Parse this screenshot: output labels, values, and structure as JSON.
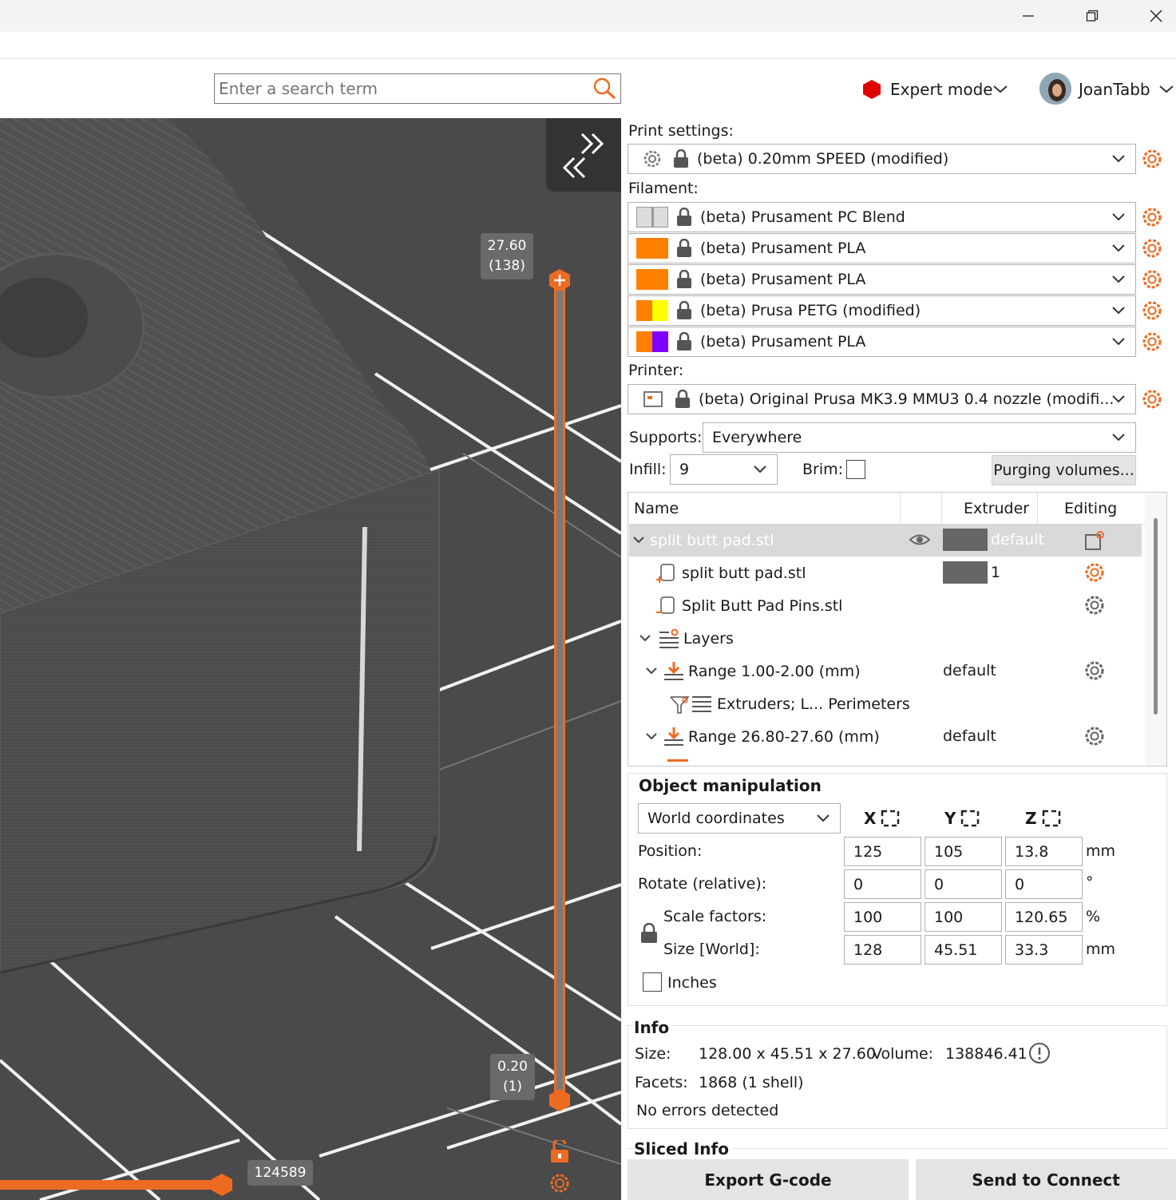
{
  "search": {
    "placeholder": "Enter a search term"
  },
  "mode": {
    "label": "Expert mode"
  },
  "user": {
    "name": "JoanTabb"
  },
  "viewport": {
    "top_slider": {
      "height": "27.60",
      "layer": "(138)"
    },
    "bottom_slider": {
      "height": "0.20",
      "layer": "(1)"
    },
    "h_slider": {
      "value": "124589"
    }
  },
  "print_settings": {
    "label": "Print settings:",
    "value": "(beta) 0.20mm SPEED (modified)"
  },
  "filament": {
    "label": "Filament:",
    "items": [
      {
        "name": "(beta) Prusament PC Blend",
        "colors": [
          "#dcdcdc",
          "#dcdcdc"
        ]
      },
      {
        "name": "(beta) Prusament PLA",
        "colors": [
          "#ff7f00",
          "#ff7f00"
        ]
      },
      {
        "name": "(beta) Prusament PLA",
        "colors": [
          "#ff7f00",
          "#ff7f00"
        ]
      },
      {
        "name": "(beta) Prusa PETG (modified)",
        "colors": [
          "#ff7f00",
          "#ffff00"
        ]
      },
      {
        "name": "(beta) Prusament PLA",
        "colors": [
          "#ff7f00",
          "#8000ff"
        ]
      }
    ]
  },
  "printer": {
    "label": "Printer:",
    "value": "(beta) Original Prusa MK3.9 MMU3 0.4 nozzle (modifi..."
  },
  "supports": {
    "label": "Supports:",
    "value": "Everywhere"
  },
  "infill": {
    "label": "Infill:",
    "value": "9"
  },
  "brim": {
    "label": "Brim:"
  },
  "purging_button": "Purging volumes...",
  "object_list": {
    "headers": {
      "name": "Name",
      "extruder": "Extruder",
      "editing": "Editing"
    },
    "rows": [
      {
        "name": "split butt pad.stl",
        "extruder": "default"
      },
      {
        "name": "split butt pad.stl",
        "extruder": "1"
      },
      {
        "name": "Split Butt Pad Pins.stl",
        "extruder": ""
      },
      {
        "name": "Layers",
        "extruder": ""
      },
      {
        "name": "Range 1.00-2.00 (mm)",
        "extruder": "default"
      },
      {
        "name": "Extruders; L... Perimeters",
        "extruder": ""
      },
      {
        "name": "Range 26.80-27.60 (mm)",
        "extruder": "default"
      }
    ]
  },
  "object_manipulation": {
    "title": "Object manipulation",
    "coord_system": "World coordinates",
    "axes": {
      "x": "X",
      "y": "Y",
      "z": "Z"
    },
    "position": {
      "label": "Position:",
      "x": "125",
      "y": "105",
      "z": "13.8",
      "unit": "mm"
    },
    "rotate": {
      "label": "Rotate (relative):",
      "x": "0",
      "y": "0",
      "z": "0",
      "unit": "°"
    },
    "scale": {
      "label": "Scale factors:",
      "x": "100",
      "y": "100",
      "z": "120.65",
      "unit": "%"
    },
    "size": {
      "label": "Size [World]:",
      "x": "128",
      "y": "45.51",
      "z": "33.3",
      "unit": "mm"
    },
    "inches_label": "Inches"
  },
  "info": {
    "title": "Info",
    "size_label": "Size:",
    "size_value": "128.00 x 45.51 x 27.60",
    "volume_label": "Volume:",
    "volume_value": "138846.41",
    "facets_label": "Facets:",
    "facets_value": "1868 (1 shell)",
    "errors": "No errors detected"
  },
  "sliced_info": {
    "title": "Sliced Info"
  },
  "buttons": {
    "export": "Export G-code",
    "send": "Send to Connect"
  },
  "colors": {
    "accent": "#ed6b21",
    "viewport_bg": "#4a4a4a",
    "selected_row": "#d9d9d9"
  }
}
